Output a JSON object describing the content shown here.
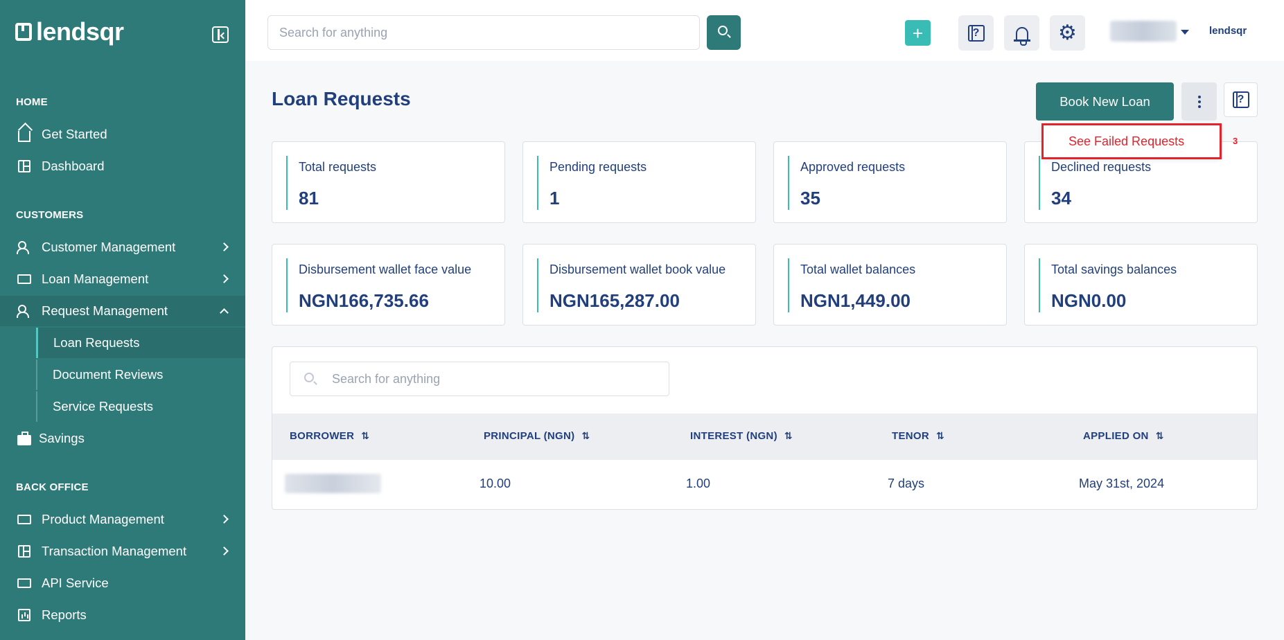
{
  "app": {
    "brand": "lendsqr",
    "brand_small": "lendsqr"
  },
  "header": {
    "search_placeholder": "Search for anything",
    "plus_label": "+"
  },
  "sidebar": {
    "sections": {
      "home": "HOME",
      "customers": "CUSTOMERS",
      "back_office": "BACK OFFICE"
    },
    "items": {
      "get_started": "Get Started",
      "dashboard": "Dashboard",
      "customer_management": "Customer Management",
      "loan_management": "Loan Management",
      "request_management": "Request Management",
      "loan_requests": "Loan Requests",
      "document_reviews": "Document Reviews",
      "service_requests": "Service Requests",
      "savings": "Savings",
      "product_management": "Product Management",
      "transaction_management": "Transaction Management",
      "api_service": "API Service",
      "reports": "Reports"
    }
  },
  "page": {
    "title": "Loan Requests",
    "book_new_loan": "Book New Loan",
    "dropdown_item": "See Failed Requests",
    "dropdown_badge": "3"
  },
  "stats": [
    {
      "label": "Total requests",
      "value": "81"
    },
    {
      "label": "Pending requests",
      "value": "1"
    },
    {
      "label": "Approved requests",
      "value": "35"
    },
    {
      "label": "Declined requests",
      "value": "34"
    },
    {
      "label": "Disbursement wallet face value",
      "value": "NGN166,735.66"
    },
    {
      "label": "Disbursement wallet book value",
      "value": "NGN165,287.00"
    },
    {
      "label": "Total wallet balances",
      "value": "NGN1,449.00"
    },
    {
      "label": "Total savings balances",
      "value": "NGN0.00"
    }
  ],
  "table": {
    "search_placeholder": "Search for anything",
    "columns": [
      "BORROWER",
      "PRINCIPAL (NGN)",
      "INTEREST (NGN)",
      "TENOR",
      "APPLIED ON"
    ],
    "rows": [
      {
        "principal": "10.00",
        "interest": "1.00",
        "tenor": "7 days",
        "applied_on": "May 31st, 2024"
      }
    ]
  },
  "colors": {
    "sidebar": "#2e7a78",
    "accent": "#39bcb6",
    "text": "#213f7d",
    "alert": "#e3222a"
  }
}
